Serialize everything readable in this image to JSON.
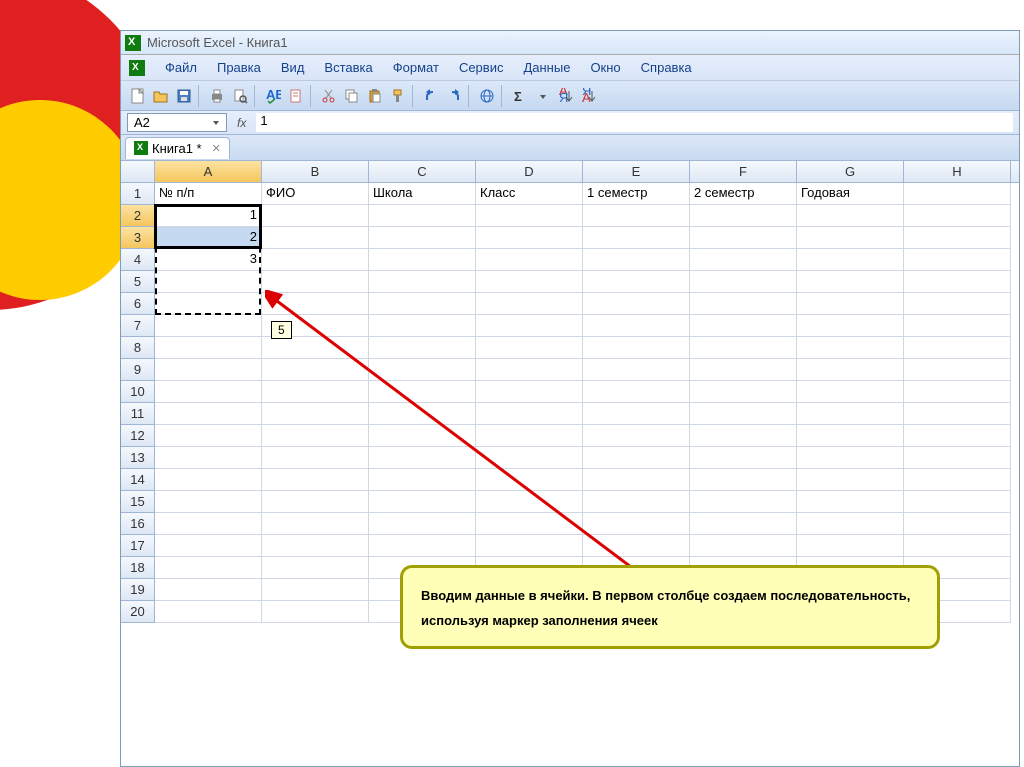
{
  "title": "Microsoft Excel - Книга1",
  "menu": [
    "Файл",
    "Правка",
    "Вид",
    "Вставка",
    "Формат",
    "Сервис",
    "Данные",
    "Окно",
    "Справка"
  ],
  "name_box": "A2",
  "fx": "fx",
  "formula_value": "1",
  "workbook_tab": "Книга1 *",
  "columns": [
    "A",
    "B",
    "C",
    "D",
    "E",
    "F",
    "G",
    "H"
  ],
  "rows": [
    "1",
    "2",
    "3",
    "4",
    "5",
    "6",
    "7",
    "8",
    "9",
    "10",
    "11",
    "12",
    "13",
    "14",
    "15",
    "16",
    "17",
    "18",
    "19",
    "20"
  ],
  "headers": [
    "№ п/п",
    "ФИО",
    "Школа",
    "Класс",
    "1 семестр",
    "2 семестр",
    "Годовая",
    ""
  ],
  "colA": [
    "1",
    "2",
    "3"
  ],
  "drag_tooltip": "5",
  "callout": "Вводим данные в ячейки. В первом столбце создаем последовательность, используя маркер заполнения ячеек",
  "icons": {
    "new": "#f8f8f8",
    "open": "#f4c55b",
    "save": "#4a7fc4",
    "print": "#888",
    "preview": "#ddd",
    "spell": "#1e66d0",
    "cut": "#c33",
    "copy": "#d89e3e",
    "paste": "#d89e3e",
    "fmt": "#f4c55b",
    "undo": "#2967c0",
    "redo": "#2967c0",
    "link": "#2967c0",
    "sum": "#333",
    "sortA": "#333",
    "sortD": "#333"
  }
}
